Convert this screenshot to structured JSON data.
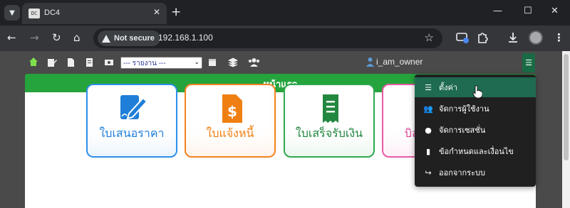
{
  "browser": {
    "tab_title": "DC4",
    "favicon_text": "DC",
    "security_label": "Not secure",
    "url": "192.168.1.100"
  },
  "toolbar": {
    "report_select": {
      "selected": "--- รายงาน ---"
    },
    "username": "i_am_owner"
  },
  "page": {
    "title": "หน้าแรก"
  },
  "cards": [
    {
      "label": "ใบเสนอราคา",
      "color": "#2f90e8",
      "icon": "quotation-icon"
    },
    {
      "label": "ใบแจ้งหนี้",
      "color": "#f4821f",
      "icon": "invoice-icon"
    },
    {
      "label": "ใบเสร็จรับเงิน",
      "color": "#2fa84f",
      "icon": "receipt-icon"
    },
    {
      "label": "บิลเงินสด",
      "color": "#e75aa4",
      "icon": "cash-bill-icon"
    }
  ],
  "menu": {
    "items": [
      {
        "label": "ตั้งค่า",
        "icon": "settings-sliders-icon",
        "active": true
      },
      {
        "label": "จัดการผู้ใช้งาน",
        "icon": "users-icon",
        "active": false
      },
      {
        "label": "จัดการเซสชั่น",
        "icon": "user-session-icon",
        "active": false
      },
      {
        "label": "ข้อกำหนดและเงื่อนไข",
        "icon": "document-icon",
        "active": false
      },
      {
        "label": "ออกจากระบบ",
        "icon": "logout-icon",
        "active": false
      }
    ]
  },
  "colors": {
    "header_green": "#25a33c",
    "menu_active": "#1f6b52",
    "hamburger": "#1a6b45"
  }
}
